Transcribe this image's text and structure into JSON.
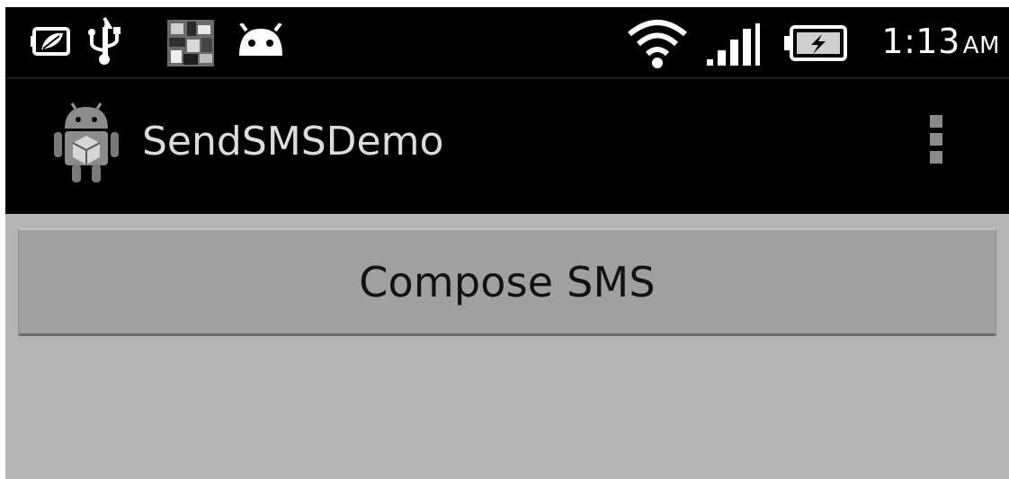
{
  "status_bar": {
    "time": "1:13",
    "ampm": "AM",
    "left_icons": [
      "battery-saver-icon",
      "usb-icon",
      "photo-notification-icon",
      "android-debug-icon"
    ],
    "right_icons": [
      "wifi-icon",
      "signal-icon",
      "battery-charging-icon"
    ]
  },
  "action_bar": {
    "title": "SendSMSDemo",
    "icon": "android-app-icon",
    "menu_icon": "overflow-menu-icon"
  },
  "main": {
    "compose_button_label": "Compose SMS"
  },
  "colors": {
    "status_bar_bg": "#000000",
    "action_bar_bg": "#000000",
    "content_bg": "#b5b5b5",
    "button_bg": "#a0a0a0",
    "title_text": "#dcdcdc"
  }
}
